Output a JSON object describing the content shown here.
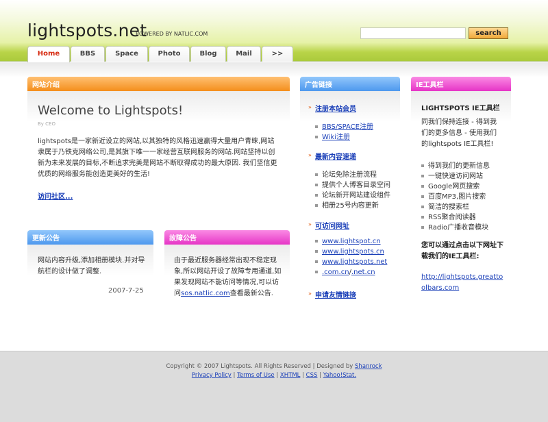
{
  "header": {
    "logo": "lightspots.net",
    "powered": "POWERED BY NATLIC.COM",
    "search_placeholder": "",
    "search_button": "search"
  },
  "nav": {
    "tabs": [
      {
        "label": "Home"
      },
      {
        "label": "BBS"
      },
      {
        "label": "Space"
      },
      {
        "label": "Photo"
      },
      {
        "label": "Blog"
      },
      {
        "label": "Mail"
      },
      {
        "label": ">>"
      }
    ]
  },
  "intro": {
    "header": "网站介绍",
    "title": "Welcome to Lightspots!",
    "byline": "By CEO",
    "body": "lightspots是一家新近设立的网站,以其独特的风格迅速赢得大量用户青睐,网站隶属于乃铁克网络公司,是其旗下唯一一家经营互联网服务的网站.网站坚持以创新为未来发展的目标,不断追求完美是网站不断取得成功的最大原因. 我们坚信更优质的网络服务能创造更美好的生活!",
    "link": "访问社区..."
  },
  "update": {
    "header": "更新公告",
    "body": "网站内容升级,添加相册模块.并对导航栏的设计做了调整.",
    "date": "2007-7-25"
  },
  "fault": {
    "header": "故障公告",
    "body_before": "由于最近服务器经常出现不稳定现象,所以网站开设了故障专用通道,如果发现网站不能访问等情况,可以访问",
    "link": "sos.natlic.com",
    "body_after": "查看最新公告."
  },
  "ads": {
    "header": "广告链接",
    "sec1": "注册本站会员",
    "sec1_items": [
      "BBS/SPACE注册",
      "Wiki注册"
    ],
    "sec2": "最新内容速递",
    "sec2_items": [
      "论坛免除注册流程",
      "提供个人博客目录空间",
      "论坛新开网站建设组件",
      "相册25号内容更新"
    ],
    "sec3": "可访问网址",
    "sec3_items": [
      "www.lightspot.cn",
      "www.lightspots.cn",
      "www.lightspots.net"
    ],
    "sec3_extra_a": ".com.cn",
    "sec3_extra_sep": "/",
    "sec3_extra_b": ".net.cn",
    "sec4": "申请友情链接"
  },
  "ie": {
    "header": "IE工具栏",
    "title": "LIGHTSPOTS IE工具栏",
    "desc": "同我们保持连接 - 得到我们的更多信息 - 使用我们的lightspots IE工具栏!",
    "features": [
      "得到我们的更新信息",
      "一键快速访问网站",
      "Google网页搜索",
      "百度MP3,图片搜索",
      "简洁的搜索栏",
      "RSS聚合阅读器",
      "Radio广播收音模块"
    ],
    "download_text": "您可以通过点击以下网址下载我们的IE工具栏:",
    "url": "http://lightspots.greattoolbars.com"
  },
  "footer": {
    "copyright": "Copyright © 2007 Lightspots. All Rights Reserved | Designed by",
    "designer": "Shanrock",
    "links": [
      "Privacy Policy",
      "Terms of Use",
      "XHTML",
      "CSS",
      "Yahoo!Stat."
    ],
    "sep": "|"
  },
  "colors": {
    "header_green": "#a9c93a",
    "orange": "#f48e1c",
    "blue": "#4d98ee",
    "pink": "#e635c6",
    "link": "#1a3fb8",
    "active_tab": "#d62a10"
  }
}
